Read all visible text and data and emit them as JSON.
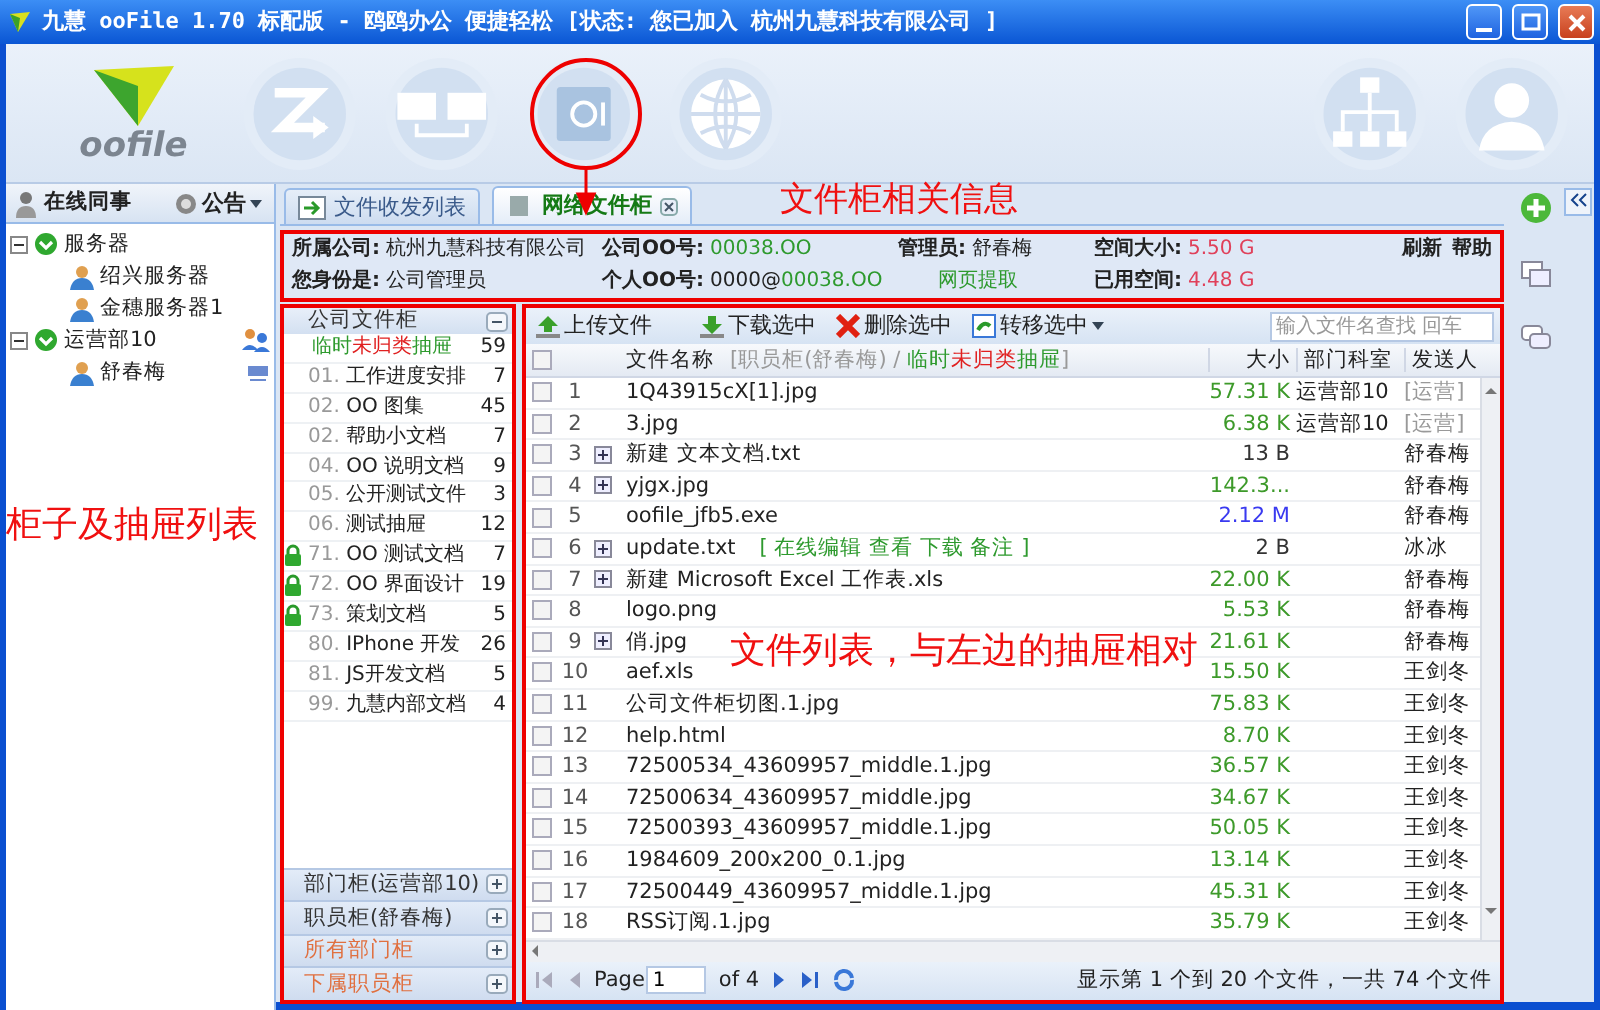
{
  "window": {
    "title": "九慧 ooFile 1.70 标配版 - 鸥鸥办公 便捷轻松 [状态: 您已加入 杭州九慧科技有限公司 ]"
  },
  "logo": {
    "text": "oofile"
  },
  "nav": [
    {
      "kind": "transfer",
      "circled": false
    },
    {
      "kind": "monitors",
      "circled": false
    },
    {
      "kind": "safe",
      "circled": true
    },
    {
      "kind": "globe",
      "circled": false
    },
    {
      "kind": "org",
      "circled": false
    },
    {
      "kind": "user",
      "circled": false
    }
  ],
  "colleagues": {
    "title": "在线同事",
    "notice": "公告",
    "tree": [
      {
        "label": "服务器",
        "expanded": true,
        "children": [
          {
            "label": "绍兴服务器"
          },
          {
            "label": "金穗服务器1"
          }
        ]
      },
      {
        "label": "运营部10",
        "expanded": true,
        "children": [
          {
            "label": "舒春梅"
          }
        ]
      }
    ]
  },
  "tabs": [
    {
      "label": "文件收发列表",
      "selected": false,
      "closable": false
    },
    {
      "label": "网络文件柜",
      "selected": true,
      "closable": true
    }
  ],
  "info": {
    "rows": [
      {
        "cells": [
          {
            "label": "所属公司:",
            "value": [
              {
                "text": "杭州九慧科技有限公司",
                "color": "#222222"
              }
            ]
          },
          {
            "label": "公司OO号:",
            "value": [
              {
                "text": "00038.OO",
                "color": "#2e9a2e"
              }
            ]
          },
          {
            "label": "管理员:",
            "value": [
              {
                "text": "舒春梅",
                "color": "#222222"
              }
            ]
          },
          {
            "label": "空间大小:",
            "value": [
              {
                "text": "5.50 G",
                "color": "#e0405a"
              }
            ]
          }
        ],
        "links": [
          "刷新",
          "帮助"
        ]
      },
      {
        "cells": [
          {
            "label": "您身份是:",
            "value": [
              {
                "text": "公司管理员",
                "color": "#222222"
              }
            ]
          },
          {
            "label": "个人OO号:",
            "value": [
              {
                "text": "0000@",
                "color": "#222222"
              },
              {
                "text": "00038.OO",
                "color": "#2e9a2e"
              }
            ]
          },
          {
            "link": "网页提取"
          },
          {
            "label": "已用空间:",
            "value": [
              {
                "text": "4.48 G",
                "color": "#e0405a"
              }
            ]
          }
        ],
        "links": []
      }
    ]
  },
  "drawers": {
    "section": "公司文件柜",
    "expanded": true,
    "items": [
      {
        "parts": [
          {
            "text": "临时",
            "color": "#2e9a2e"
          },
          {
            "text": "未归类",
            "color": "#e02020"
          },
          {
            "text": "抽屉",
            "color": "#2e9a2e"
          }
        ],
        "count": "59",
        "locked": false
      },
      {
        "number": "01.",
        "name": "工作进度安排",
        "count": "7",
        "locked": false
      },
      {
        "number": "02.",
        "name": "OO 图集",
        "count": "45",
        "locked": false
      },
      {
        "number": "02.",
        "name": "帮助小文档",
        "count": "7",
        "locked": false
      },
      {
        "number": "04.",
        "name": "OO 说明文档",
        "count": "9",
        "locked": false
      },
      {
        "number": "05.",
        "name": "公开测试文件",
        "count": "3",
        "locked": false
      },
      {
        "number": "06.",
        "name": "测试抽屉",
        "count": "12",
        "locked": false
      },
      {
        "number": "71.",
        "name": "OO 测试文档",
        "count": "7",
        "locked": true
      },
      {
        "number": "72.",
        "name": "OO 界面设计",
        "count": "19",
        "locked": true
      },
      {
        "number": "73.",
        "name": "策划文档",
        "count": "5",
        "locked": true
      },
      {
        "number": "80.",
        "name": "IPhone 开发",
        "count": "26",
        "locked": false
      },
      {
        "number": "81.",
        "name": "JS开发文档",
        "count": "5",
        "locked": false
      },
      {
        "number": "99.",
        "name": "九慧内部文档",
        "count": "4",
        "locked": false
      }
    ],
    "cabinets": [
      {
        "label": "部门柜(运营部10)",
        "color": "#333333"
      },
      {
        "label": "职员柜(舒春梅)",
        "color": "#333333"
      },
      {
        "label": "所有部门柜",
        "color": "#e07040"
      },
      {
        "label": "下属职员柜",
        "color": "#e07040"
      }
    ]
  },
  "files": {
    "toolbar": [
      {
        "kind": "upload",
        "label": "上传文件",
        "dropdown": false
      },
      {
        "kind": "download",
        "label": "下载选中",
        "dropdown": false
      },
      {
        "kind": "delete",
        "label": "删除选中",
        "dropdown": false
      },
      {
        "kind": "move",
        "label": "转移选中",
        "dropdown": true
      }
    ],
    "search": {
      "placeholder": "输入文件名查找 回车"
    },
    "columns": {
      "all_checked": false,
      "name": "文件名称",
      "path": [
        {
          "text": "[职员柜(舒春梅) / ",
          "color": "#999999"
        },
        {
          "text": "临时",
          "color": "#2e9a2e"
        },
        {
          "text": "未归类",
          "color": "#e02020"
        },
        {
          "text": "抽屉",
          "color": "#2e9a2e"
        },
        {
          "text": "]",
          "color": "#999999"
        }
      ],
      "size": "大小",
      "dept": "部门科室",
      "sender": "发送人"
    },
    "rows": [
      {
        "no": "1",
        "name": "1Q43915cX[1].jpg",
        "expandable": false,
        "checked": false,
        "size": "57.31 K",
        "color": "#3d9a2a",
        "dept": "运营部10",
        "sender": "[运营]"
      },
      {
        "no": "2",
        "name": "3.jpg",
        "expandable": false,
        "checked": false,
        "size": "6.38 K",
        "color": "#3d9a2a",
        "dept": "运营部10",
        "sender": "[运营]"
      },
      {
        "no": "3",
        "name": "新建 文本文档.txt",
        "expandable": true,
        "checked": false,
        "size": "13 B",
        "color": "#333333",
        "sender": "舒春梅"
      },
      {
        "no": "4",
        "name": "yjgx.jpg",
        "expandable": true,
        "checked": false,
        "size": "142.3...",
        "color": "#3d9a2a",
        "sender": "舒春梅"
      },
      {
        "no": "5",
        "name": "oofile_jfb5.exe",
        "expandable": false,
        "checked": false,
        "size": "2.12 M",
        "color": "#3a3af0",
        "sender": "舒春梅"
      },
      {
        "no": "6",
        "name": "update.txt",
        "expandable": true,
        "checked": false,
        "actions": "[ 在线编辑 查看 下载 备注 ]",
        "size": "2 B",
        "color": "#333333",
        "sender": "冰冰"
      },
      {
        "no": "7",
        "name": "新建 Microsoft Excel 工作表.xls",
        "expandable": true,
        "checked": false,
        "size": "22.00 K",
        "color": "#3d9a2a",
        "sender": "舒春梅"
      },
      {
        "no": "8",
        "name": "logo.png",
        "expandable": false,
        "checked": false,
        "size": "5.53 K",
        "color": "#3d9a2a",
        "sender": "舒春梅"
      },
      {
        "no": "9",
        "name": "俏.jpg",
        "expandable": true,
        "checked": false,
        "size": "21.61 K",
        "color": "#3d9a2a",
        "sender": "舒春梅"
      },
      {
        "no": "10",
        "name": "aef.xls",
        "expandable": false,
        "checked": false,
        "size": "15.50 K",
        "color": "#3d9a2a",
        "sender": "王剑冬"
      },
      {
        "no": "11",
        "name": "公司文件柜切图.1.jpg",
        "expandable": false,
        "checked": false,
        "size": "75.83 K",
        "color": "#3d9a2a",
        "sender": "王剑冬"
      },
      {
        "no": "12",
        "name": "help.html",
        "expandable": false,
        "checked": false,
        "size": "8.70 K",
        "color": "#3d9a2a",
        "sender": "王剑冬"
      },
      {
        "no": "13",
        "name": "72500534_43609957_middle.1.jpg",
        "expandable": false,
        "checked": false,
        "size": "36.57 K",
        "color": "#3d9a2a",
        "sender": "王剑冬"
      },
      {
        "no": "14",
        "name": "72500634_43609957_middle.jpg",
        "expandable": false,
        "checked": false,
        "size": "34.67 K",
        "color": "#3d9a2a",
        "sender": "王剑冬"
      },
      {
        "no": "15",
        "name": "72500393_43609957_middle.1.jpg",
        "expandable": false,
        "checked": false,
        "size": "50.05 K",
        "color": "#3d9a2a",
        "sender": "王剑冬"
      },
      {
        "no": "16",
        "name": "1984609_200x200_0.1.jpg",
        "expandable": false,
        "checked": false,
        "size": "13.14 K",
        "color": "#3d9a2a",
        "sender": "王剑冬"
      },
      {
        "no": "17",
        "name": "72500449_43609957_middle.1.jpg",
        "expandable": false,
        "checked": false,
        "size": "45.31 K",
        "color": "#3d9a2a",
        "sender": "王剑冬"
      },
      {
        "no": "18",
        "name": "RSS订阅.1.jpg",
        "expandable": false,
        "checked": false,
        "size": "35.79 K",
        "color": "#3d9a2a",
        "sender": "王剑冬"
      }
    ],
    "pager": {
      "page_label": "Page",
      "page": "1",
      "of": "of 4",
      "status": "显示第 1 个到 20 个文件，一共 74 个文件"
    }
  },
  "annotations": [
    {
      "text": "文件柜相关信息"
    },
    {
      "text": "柜子及抽屉列表"
    },
    {
      "text": "文件列表，与左边的抽屉相对"
    }
  ]
}
